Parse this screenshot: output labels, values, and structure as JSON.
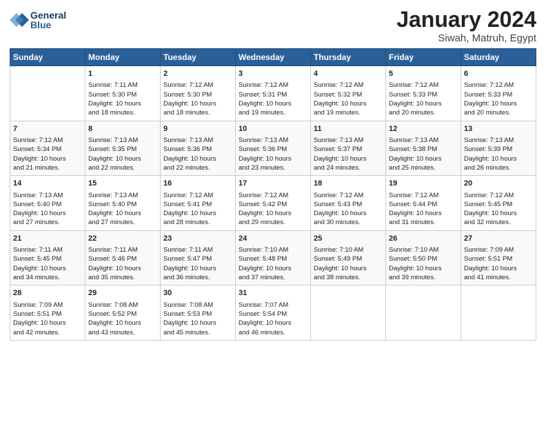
{
  "header": {
    "logo_line1": "General",
    "logo_line2": "Blue",
    "title": "January 2024",
    "subtitle": "Siwah, Matruh, Egypt"
  },
  "weekdays": [
    "Sunday",
    "Monday",
    "Tuesday",
    "Wednesday",
    "Thursday",
    "Friday",
    "Saturday"
  ],
  "weeks": [
    [
      {
        "day": "",
        "content": ""
      },
      {
        "day": "1",
        "content": "Sunrise: 7:11 AM\nSunset: 5:30 PM\nDaylight: 10 hours\nand 18 minutes."
      },
      {
        "day": "2",
        "content": "Sunrise: 7:12 AM\nSunset: 5:30 PM\nDaylight: 10 hours\nand 18 minutes."
      },
      {
        "day": "3",
        "content": "Sunrise: 7:12 AM\nSunset: 5:31 PM\nDaylight: 10 hours\nand 19 minutes."
      },
      {
        "day": "4",
        "content": "Sunrise: 7:12 AM\nSunset: 5:32 PM\nDaylight: 10 hours\nand 19 minutes."
      },
      {
        "day": "5",
        "content": "Sunrise: 7:12 AM\nSunset: 5:33 PM\nDaylight: 10 hours\nand 20 minutes."
      },
      {
        "day": "6",
        "content": "Sunrise: 7:12 AM\nSunset: 5:33 PM\nDaylight: 10 hours\nand 20 minutes."
      }
    ],
    [
      {
        "day": "7",
        "content": "Sunrise: 7:12 AM\nSunset: 5:34 PM\nDaylight: 10 hours\nand 21 minutes."
      },
      {
        "day": "8",
        "content": "Sunrise: 7:13 AM\nSunset: 5:35 PM\nDaylight: 10 hours\nand 22 minutes."
      },
      {
        "day": "9",
        "content": "Sunrise: 7:13 AM\nSunset: 5:36 PM\nDaylight: 10 hours\nand 22 minutes."
      },
      {
        "day": "10",
        "content": "Sunrise: 7:13 AM\nSunset: 5:36 PM\nDaylight: 10 hours\nand 23 minutes."
      },
      {
        "day": "11",
        "content": "Sunrise: 7:13 AM\nSunset: 5:37 PM\nDaylight: 10 hours\nand 24 minutes."
      },
      {
        "day": "12",
        "content": "Sunrise: 7:13 AM\nSunset: 5:38 PM\nDaylight: 10 hours\nand 25 minutes."
      },
      {
        "day": "13",
        "content": "Sunrise: 7:13 AM\nSunset: 5:39 PM\nDaylight: 10 hours\nand 26 minutes."
      }
    ],
    [
      {
        "day": "14",
        "content": "Sunrise: 7:13 AM\nSunset: 5:40 PM\nDaylight: 10 hours\nand 27 minutes."
      },
      {
        "day": "15",
        "content": "Sunrise: 7:13 AM\nSunset: 5:40 PM\nDaylight: 10 hours\nand 27 minutes."
      },
      {
        "day": "16",
        "content": "Sunrise: 7:12 AM\nSunset: 5:41 PM\nDaylight: 10 hours\nand 28 minutes."
      },
      {
        "day": "17",
        "content": "Sunrise: 7:12 AM\nSunset: 5:42 PM\nDaylight: 10 hours\nand 29 minutes."
      },
      {
        "day": "18",
        "content": "Sunrise: 7:12 AM\nSunset: 5:43 PM\nDaylight: 10 hours\nand 30 minutes."
      },
      {
        "day": "19",
        "content": "Sunrise: 7:12 AM\nSunset: 5:44 PM\nDaylight: 10 hours\nand 31 minutes."
      },
      {
        "day": "20",
        "content": "Sunrise: 7:12 AM\nSunset: 5:45 PM\nDaylight: 10 hours\nand 32 minutes."
      }
    ],
    [
      {
        "day": "21",
        "content": "Sunrise: 7:11 AM\nSunset: 5:45 PM\nDaylight: 10 hours\nand 34 minutes."
      },
      {
        "day": "22",
        "content": "Sunrise: 7:11 AM\nSunset: 5:46 PM\nDaylight: 10 hours\nand 35 minutes."
      },
      {
        "day": "23",
        "content": "Sunrise: 7:11 AM\nSunset: 5:47 PM\nDaylight: 10 hours\nand 36 minutes."
      },
      {
        "day": "24",
        "content": "Sunrise: 7:10 AM\nSunset: 5:48 PM\nDaylight: 10 hours\nand 37 minutes."
      },
      {
        "day": "25",
        "content": "Sunrise: 7:10 AM\nSunset: 5:49 PM\nDaylight: 10 hours\nand 38 minutes."
      },
      {
        "day": "26",
        "content": "Sunrise: 7:10 AM\nSunset: 5:50 PM\nDaylight: 10 hours\nand 39 minutes."
      },
      {
        "day": "27",
        "content": "Sunrise: 7:09 AM\nSunset: 5:51 PM\nDaylight: 10 hours\nand 41 minutes."
      }
    ],
    [
      {
        "day": "28",
        "content": "Sunrise: 7:09 AM\nSunset: 5:51 PM\nDaylight: 10 hours\nand 42 minutes."
      },
      {
        "day": "29",
        "content": "Sunrise: 7:08 AM\nSunset: 5:52 PM\nDaylight: 10 hours\nand 43 minutes."
      },
      {
        "day": "30",
        "content": "Sunrise: 7:08 AM\nSunset: 5:53 PM\nDaylight: 10 hours\nand 45 minutes."
      },
      {
        "day": "31",
        "content": "Sunrise: 7:07 AM\nSunset: 5:54 PM\nDaylight: 10 hours\nand 46 minutes."
      },
      {
        "day": "",
        "content": ""
      },
      {
        "day": "",
        "content": ""
      },
      {
        "day": "",
        "content": ""
      }
    ]
  ]
}
